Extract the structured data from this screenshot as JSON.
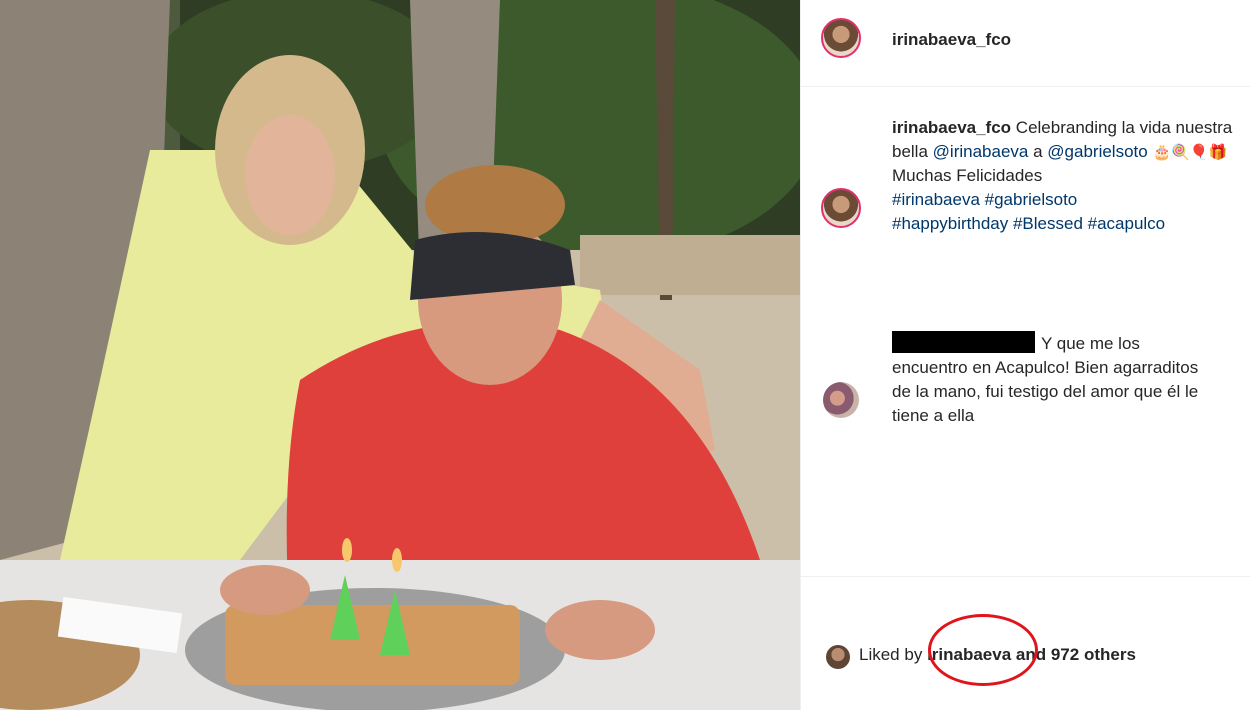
{
  "post": {
    "username": "irinabaeva_fco",
    "caption": {
      "username": "irinabaeva_fco",
      "text_before": "Celebranding la vida nuestra bella",
      "mention1": "@irinabaeva",
      "text_mid": "a",
      "mention2": "@gabrielsoto",
      "emojis": "🎂🍭🎈🎁",
      "text_after": "Muchas Felicidades",
      "hashtags1": "#irinabaeva #gabrielsoto",
      "hashtags2": "#happybirthday #Blessed #acapulco"
    },
    "comment": {
      "text": "Y que me los encuentro en Acapulco! Bien agarraditos de la mano, fui testigo del amor que él le tiene a ella"
    },
    "likes": {
      "prefix": "Liked by",
      "user": "irinabaeva",
      "suffix": "and 972 others"
    }
  },
  "colors": {
    "annotation_circle": "#e0141b",
    "link": "#00376b",
    "text": "#262626"
  },
  "icons": [
    "profile-avatar",
    "commenter-avatar",
    "liker-avatar"
  ]
}
